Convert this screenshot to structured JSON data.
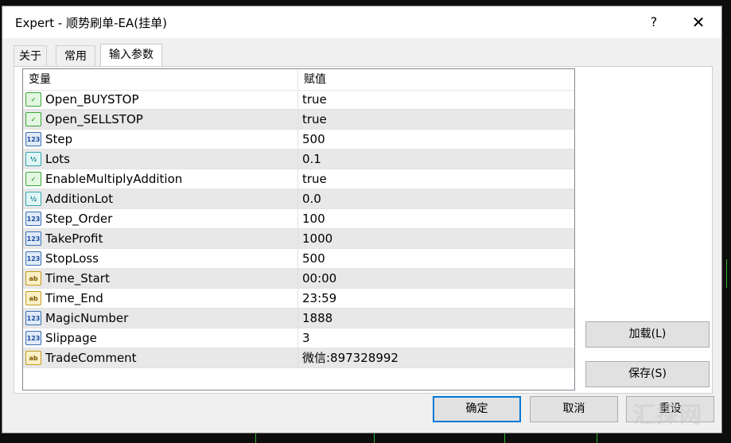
{
  "window": {
    "title": "Expert - 顺势刷单-EA(挂单)",
    "help_glyph": "?",
    "close_glyph": "✕"
  },
  "tabs": [
    {
      "label": "关于",
      "active": false
    },
    {
      "label": "常用",
      "active": false
    },
    {
      "label": "输入参数",
      "active": true
    }
  ],
  "grid": {
    "col_variable": "变量",
    "col_value": "赋值",
    "rows": [
      {
        "icon": "bool-icon",
        "icon_text": "✓",
        "name": "Open_BUYSTOP",
        "value": "true"
      },
      {
        "icon": "bool-icon",
        "icon_text": "✓",
        "name": "Open_SELLSTOP",
        "value": "true"
      },
      {
        "icon": "int-icon",
        "icon_text": "123",
        "name": "Step",
        "value": "500"
      },
      {
        "icon": "double-icon",
        "icon_text": "½",
        "name": "Lots",
        "value": "0.1"
      },
      {
        "icon": "bool-icon",
        "icon_text": "✓",
        "name": "EnableMultiplyAddition",
        "value": "true"
      },
      {
        "icon": "double-icon",
        "icon_text": "½",
        "name": "AdditionLot",
        "value": "0.0"
      },
      {
        "icon": "int-icon",
        "icon_text": "123",
        "name": "Step_Order",
        "value": "100"
      },
      {
        "icon": "int-icon",
        "icon_text": "123",
        "name": "TakeProfit",
        "value": "1000"
      },
      {
        "icon": "int-icon",
        "icon_text": "123",
        "name": "StopLoss",
        "value": "500"
      },
      {
        "icon": "string-icon",
        "icon_text": "ab",
        "name": "Time_Start",
        "value": "00:00"
      },
      {
        "icon": "string-icon",
        "icon_text": "ab",
        "name": "Time_End",
        "value": "23:59"
      },
      {
        "icon": "int-icon",
        "icon_text": "123",
        "name": "MagicNumber",
        "value": "1888"
      },
      {
        "icon": "int-icon",
        "icon_text": "123",
        "name": "Slippage",
        "value": "3"
      },
      {
        "icon": "string-icon",
        "icon_text": "ab",
        "name": "TradeComment",
        "value": "微信:897328992"
      }
    ]
  },
  "buttons": {
    "load": "加载(L)",
    "save": "保存(S)",
    "ok": "确定",
    "cancel": "取消",
    "reset": "重设"
  },
  "watermark": "汇探网"
}
